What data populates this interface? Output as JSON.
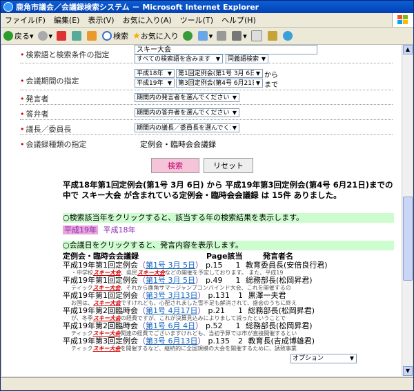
{
  "window": {
    "title": "鹿角市議会／会議録検索システム － Microsoft Internet Explorer"
  },
  "menu": [
    "ファイル(F)",
    "編集(E)",
    "表示(V)",
    "お気に入り(A)",
    "ツール(T)",
    "ヘルプ(H)"
  ],
  "toolbar": {
    "back": "戻る",
    "search": "検索",
    "favorites": "お気に入り"
  },
  "form": {
    "keyword_label": "検索語と検索条件の指定",
    "keyword_value": "スキー大会",
    "match_option": "すべての検索語を含みます",
    "synonym_option": "同義語検索",
    "period_label": "会議期間の指定",
    "from_year": "平成18年",
    "from_session": "第1回定例会(第1号 3月 6日)",
    "from_suffix": "から",
    "to_year": "平成19年",
    "to_session": "第3回定例会(第4号 6月21日)",
    "to_suffix": "まで",
    "speaker_label": "発言者",
    "speaker_select": "期間内の発言者を選んでください",
    "answerer_label": "答弁者",
    "answerer_select": "期間内の答弁者を選んでください",
    "chair_label": "議長／委員長",
    "chair_select": "期間内の議長／委員長を選んでください",
    "type_label": "会議録種類の指定",
    "type_value": "定例会・臨時会会議録",
    "search_button": "検索",
    "reset_button": "リセット"
  },
  "results": {
    "summary": "平成18年第1回定例会(第1号 3月 6日) から 平成19年第3回定例会(第4号 6月21日)までの中で スキー大会 が含まれている定例会・臨時会会議録 は 15件 ありました。",
    "year_instruction": "○検索該当年をクリックすると、該当する年の検索結果を表示します。",
    "year_current": "平成19年",
    "year_other": "平成18年",
    "date_instruction": "○会議日をクリックすると、発言内容を表示します。",
    "header_meeting": "定例会・臨時会会議録",
    "header_page": "Page該当",
    "header_speaker": "発言者名",
    "entries": [
      {
        "meeting": "平成19年第1回定例会",
        "issue": "第1号 3月 5日",
        "page": "p.15",
        "count": "1",
        "speaker": "教育委員長(安倍良行君)",
        "pre": "・中学校",
        "hl": "スキー大会",
        "post": "、県民",
        "hl2": "スキー大会",
        "post2": "などの開催を予定しております。 また、平成19"
      },
      {
        "meeting": "平成19年第1回定例会",
        "issue": "第1号 3月 5日",
        "page": "p.49",
        "count": "1",
        "speaker": "総務部長(松岡昇君)",
        "pre": "ティック",
        "hl": "スキー大会",
        "post": "、それから鹿角サマージャンプコンバインド大会、これを開催するの",
        "hl2": "",
        "post2": ""
      },
      {
        "meeting": "平成19年第1回定例会",
        "issue": "第3号 3月13日",
        "page": "p.131",
        "count": "1",
        "speaker": "黒澤一夫君",
        "pre": " お国は、",
        "hl": "スキー大会",
        "post": "ですけれども、心配されました雪不足も解消されて、盛会のうちに終え",
        "hl2": "",
        "post2": ""
      },
      {
        "meeting": "平成19年第2回臨時会",
        "issue": "第1号 4月17日",
        "page": "p.21",
        "count": "1",
        "speaker": "総務部長(松岡昇君)",
        "pre": "が、冬季",
        "hl": "スキー大会",
        "post": "の経費ですが、これが決算見込みによりまして減ったということで",
        "hl2": "",
        "post2": ""
      },
      {
        "meeting": "平成19年第2回臨時会",
        "issue": "第1号 6月 4日",
        "page": "p.52",
        "count": "1",
        "speaker": "総務部長(松岡昇君)",
        "pre": "ティック",
        "hl": "スキー大会",
        "post": "関連の経費でございますけれども、当初予算では市が直接開催するとい",
        "hl2": "",
        "post2": ""
      },
      {
        "meeting": "平成19年第3回定例会",
        "issue": "第3号 6月13日",
        "page": "p.135",
        "count": "2",
        "speaker": "教育長(吉成博雄君)",
        "pre": "ティック",
        "hl": "スキー大会",
        "post": "を開催するなど、継続的に全国規模の大会を開催するために、誘致事業",
        "hl2": "",
        "post2": ""
      }
    ],
    "options_select": "オプション"
  }
}
